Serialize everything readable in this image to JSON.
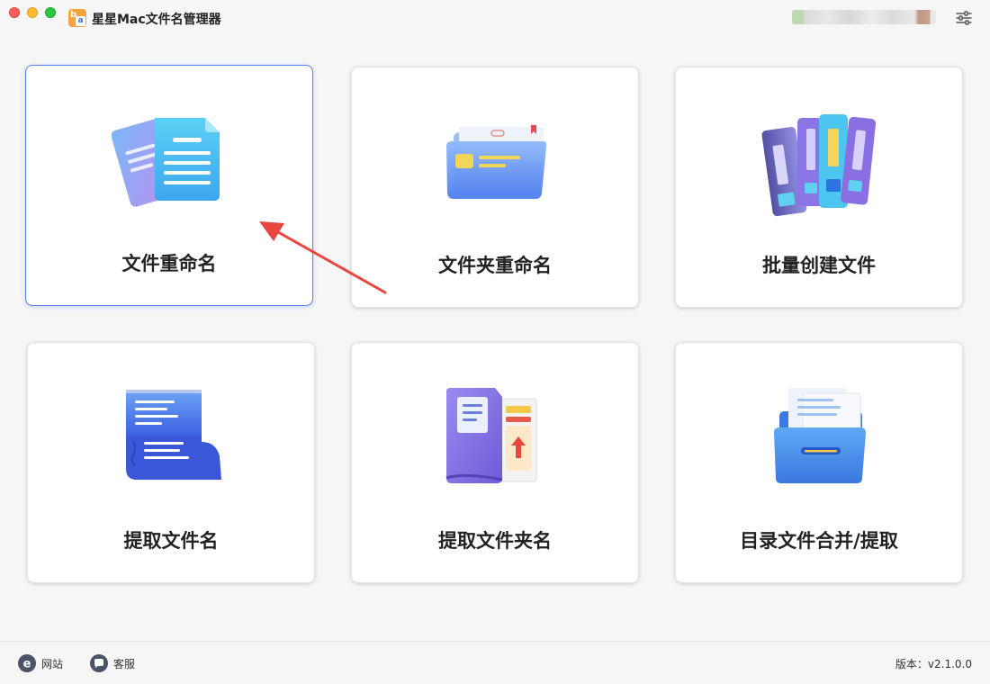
{
  "window": {
    "title": "星星Mac文件名管理器"
  },
  "icons": {
    "settings": "sliders-icon",
    "website": "ie-globe-icon",
    "support": "chat-bubble-icon"
  },
  "colors": {
    "active_border": "#5b7ff2",
    "arrow": "#e8463e"
  },
  "cards": [
    {
      "label": "文件重命名",
      "icon": "documents-icon",
      "active": true
    },
    {
      "label": "文件夹重命名",
      "icon": "folder-icon",
      "active": false
    },
    {
      "label": "批量创建文件",
      "icon": "binders-icon",
      "active": false
    },
    {
      "label": "提取文件名",
      "icon": "scroll-list-icon",
      "active": false
    },
    {
      "label": "提取文件夹名",
      "icon": "book-folder-icon",
      "active": false
    },
    {
      "label": "目录文件合并/提取",
      "icon": "file-drawer-icon",
      "active": false
    }
  ],
  "footer": {
    "website_label": "网站",
    "support_label": "客服",
    "version_label": "版本：",
    "version_value": "v2.1.0.0"
  }
}
